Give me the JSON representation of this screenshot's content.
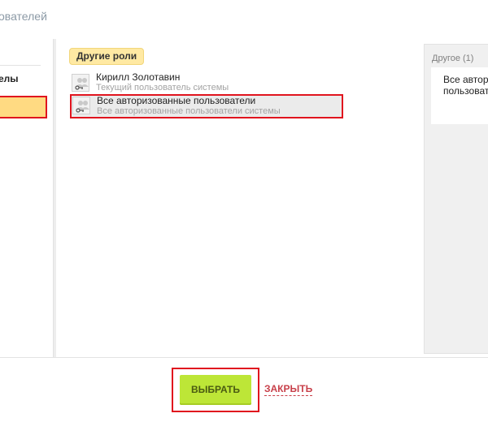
{
  "dialog": {
    "title": "ователей"
  },
  "left": {
    "item_label": "елы"
  },
  "middle": {
    "roles_tag": "Другие роли",
    "users": [
      {
        "name": "Кирилл Золотавин",
        "subtitle": "Текущий пользователь системы",
        "icon": "user-key-icon"
      },
      {
        "name": "Все авторизованные пользователи",
        "subtitle": "Все авторизованные пользователи системы",
        "icon": "user-key-icon"
      }
    ]
  },
  "right": {
    "header": "Другое (1)",
    "card_line1": "Все автор",
    "card_line2": "пользовате"
  },
  "footer": {
    "select_label": "ВЫБРАТЬ",
    "close_label": "ЗАКРЫТЬ"
  },
  "colors": {
    "accent_green": "#bde637",
    "highlight_red": "#e0141e",
    "tag_yellow": "#ffe9a3",
    "link_red": "#c8404a"
  }
}
